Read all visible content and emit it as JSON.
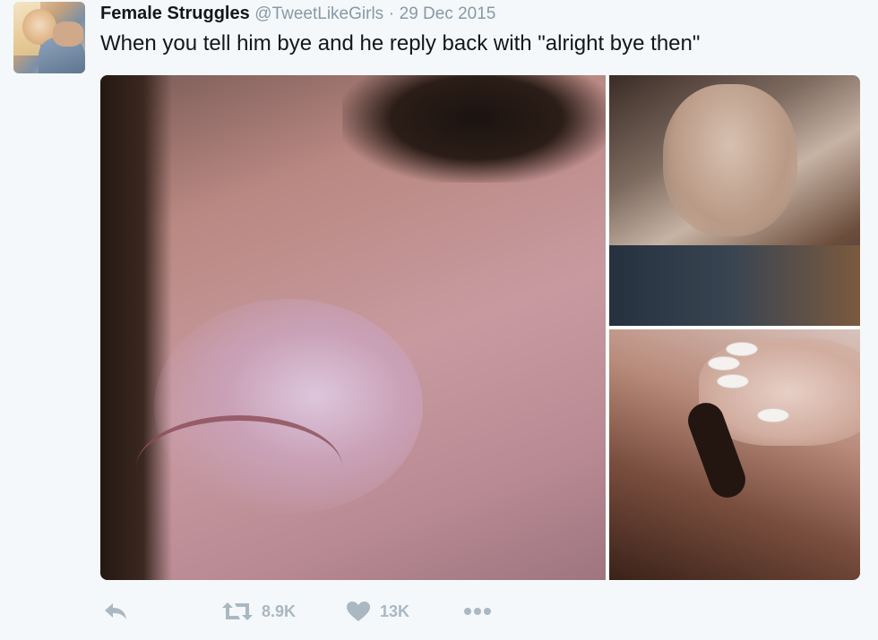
{
  "tweet": {
    "author_name": "Female Struggles",
    "handle": "@TweetLikeGirls",
    "separator": "·",
    "date": "29 Dec 2015",
    "text": "When you tell him bye and he reply back with \"alright bye then\""
  },
  "actions": {
    "retweet_count": "8.9K",
    "like_count": "13K"
  },
  "icons": [
    "reply-icon",
    "retweet-icon",
    "heart-icon",
    "more-icon"
  ],
  "colors": {
    "text": "#14171a",
    "muted": "#8899a6",
    "action": "#aab8c2",
    "background": "#f5f8fa"
  }
}
